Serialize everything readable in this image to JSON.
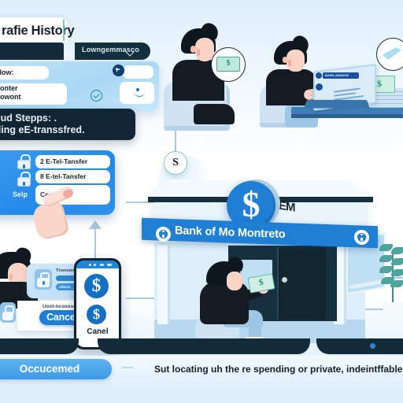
{
  "meta": {
    "accent_blue": "#1f7fd4",
    "accent_light_blue": "#5eb2ef",
    "navy": "#132b3b",
    "panel_blue": "#bfe2f7",
    "money_green": "#2d8f6e"
  },
  "browser": {
    "tab_title": "rafie History",
    "language_selector": "Lowngemmasco",
    "caret_icon": "chevron-down-icon"
  },
  "form_panel": {
    "field_a_label": "olow:",
    "field_b_line1": "monter",
    "field_b_line2": "mowont",
    "send_icon": "send-icon",
    "check_icon": "check-circle-icon"
  },
  "steps_callout": {
    "line1": "anud Stepps: .",
    "line2": "nding eE-transsfred."
  },
  "list_card": {
    "setup_label": "Selp",
    "lock_icon": "lock-icon",
    "rows": [
      {
        "label": "2 E-Tel-Tansfer"
      },
      {
        "label": "8 E-tel-Tansfer"
      },
      {
        "label": "Ceer"
      }
    ],
    "pointer_icon": "pointing-hand-icon"
  },
  "small_panel": {
    "title": "Tnonson",
    "pill1_label": "",
    "pill2_label": "odison"
  },
  "confirm_bar": {
    "caption": "Uost-ncossoehg",
    "cancel_label": "Cancel",
    "lock_icon": "lock-icon"
  },
  "phone": {
    "status_icons": "signal-wifi-battery-icons",
    "dollar_icon_large": "dollar-circle-icon",
    "dollar_icon_small": "dollar-circle-icon",
    "cancel_label": "Canel"
  },
  "scene_top_right": {
    "laptop_screen_title": "BANK-ANASOS",
    "cash_badge_icon": "cash-note-icon",
    "cash_badge_symbol": "$",
    "stack_badge_icon": "cash-stack-icon",
    "desk_cash_symbol": "$",
    "person_1": "seated-person",
    "person_2": "person-at-laptop"
  },
  "bank": {
    "sign_text": "Bank of Mo Montreto",
    "logo_icon": "bank-logo-icon",
    "coin_symbol": "$",
    "atm_label": "EM",
    "customer_cash_symbol": "$",
    "plant_icon": "potted-plant-icon"
  },
  "s_badge": {
    "label": "S"
  },
  "banner": {
    "pill_label": "Occucemed",
    "description": "Sut locating uh the re spending or private,  indeintffable cancelled.",
    "arrow_icon": "arrow-right-icon"
  }
}
